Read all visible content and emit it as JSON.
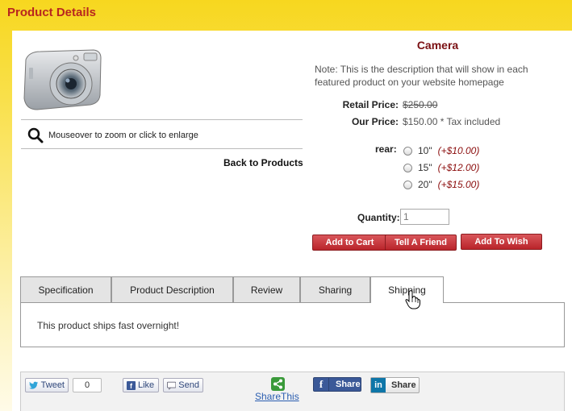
{
  "header": {
    "title": "Product Details"
  },
  "product": {
    "title": "Camera",
    "note": "Note: This is the description that will show in each featured product on your website homepage",
    "zoom_hint": "Mouseover to zoom or click to enlarge",
    "back_link": "Back to Products",
    "retail_label": "Retail Price:",
    "retail_price": "$250.00",
    "our_label": "Our Price:",
    "our_price": "$150.00 * Tax included",
    "option_label": "rear:",
    "options": [
      {
        "size": "10\"",
        "modifier": "(+$10.00)"
      },
      {
        "size": "15\"",
        "modifier": "(+$12.00)"
      },
      {
        "size": "20\"",
        "modifier": "(+$15.00)"
      }
    ],
    "quantity_label": "Quantity:",
    "quantity_value": "1"
  },
  "actions": {
    "add_to_cart": "Add to Cart",
    "tell_friend": "Tell A Friend",
    "wish_list": "Add To Wish List"
  },
  "tabs": [
    {
      "label": "Specification"
    },
    {
      "label": "Product Description"
    },
    {
      "label": "Review"
    },
    {
      "label": "Sharing"
    },
    {
      "label": "Shipping",
      "active": true
    }
  ],
  "tab_content": {
    "text": "This product ships fast overnight!"
  },
  "share": {
    "tweet": "Tweet",
    "tweet_count": "0",
    "like": "Like",
    "send": "Send",
    "sharethis": "ShareThis",
    "fb_share": "Share",
    "in_share": "Share"
  },
  "colors": {
    "accent": "#b8261f",
    "title": "#7a0f12",
    "button": "#c1353a",
    "header_bg": "#f7d71f"
  },
  "icons": [
    "magnifier-icon",
    "twitter-bird-icon",
    "facebook-icon",
    "send-icon",
    "sharethis-icon",
    "linkedin-icon",
    "hand-cursor-icon"
  ]
}
